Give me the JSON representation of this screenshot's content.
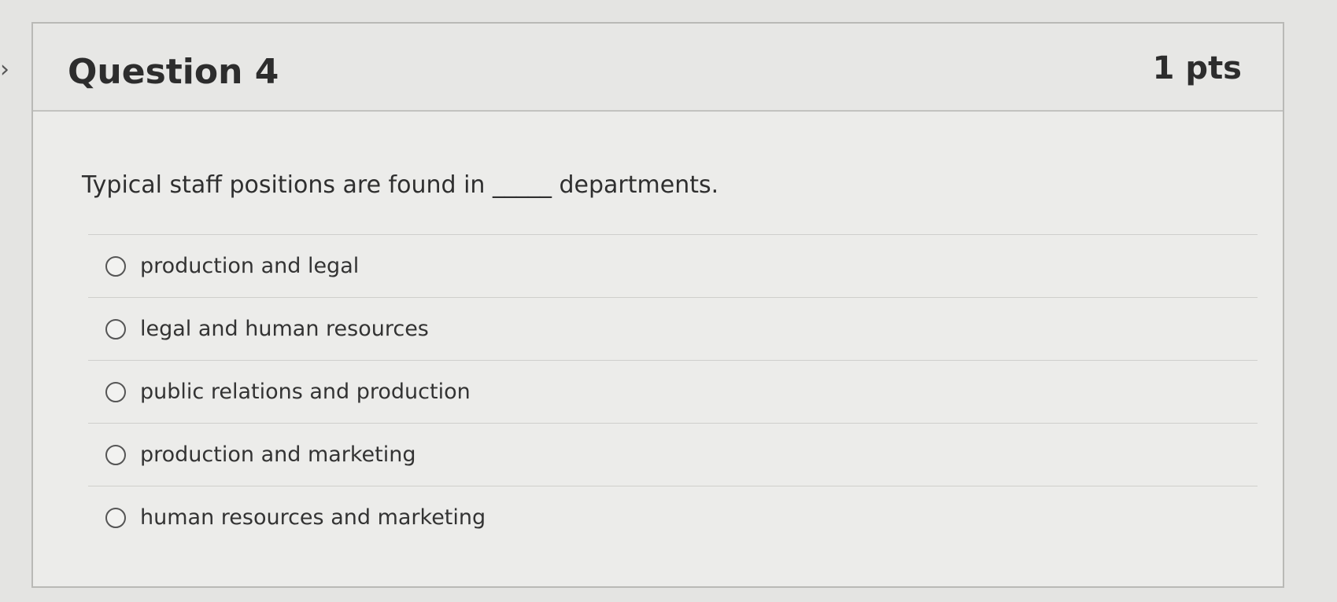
{
  "question": {
    "title": "Question 4",
    "points": "1 pts",
    "text": "Typical staff positions are found in _____ departments.",
    "options": [
      {
        "label": "production and legal"
      },
      {
        "label": "legal and human resources"
      },
      {
        "label": "public relations and production"
      },
      {
        "label": "production and marketing"
      },
      {
        "label": "human resources and marketing"
      }
    ]
  },
  "icons": {
    "nav_arrow": "chevron-right-icon"
  },
  "colors": {
    "background": "#e4e4e2",
    "card": "#ececea",
    "header": "#e7e7e5",
    "text": "#2f2f2f"
  }
}
